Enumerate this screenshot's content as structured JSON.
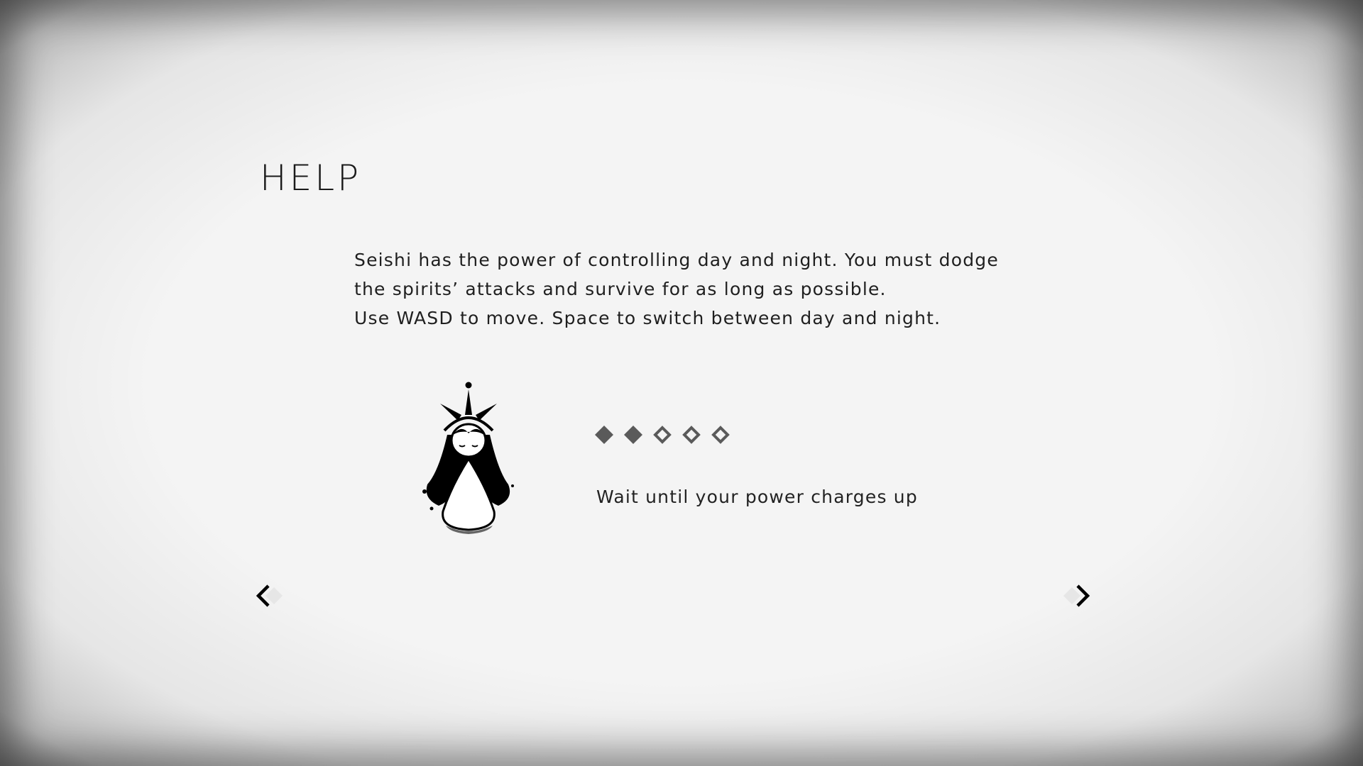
{
  "page": {
    "title": "HELP"
  },
  "intro": {
    "lines": [
      "Seishi has the power of controlling day and night. You must dodge",
      "the spirits’ attacks and survive for as long as possible.",
      "Use WASD to move. Space to switch between day and night."
    ]
  },
  "power": {
    "charged": 2,
    "total": 5,
    "filled_color": "#5a5a5a",
    "empty_color": "#5a5a5a"
  },
  "hint": {
    "text": "Wait until your power charges up"
  },
  "nav": {
    "prev_icon": "chevron-left-icon",
    "next_icon": "chevron-right-icon"
  },
  "colors": {
    "background": "#f4f4f4",
    "text": "#1c1c1c"
  }
}
